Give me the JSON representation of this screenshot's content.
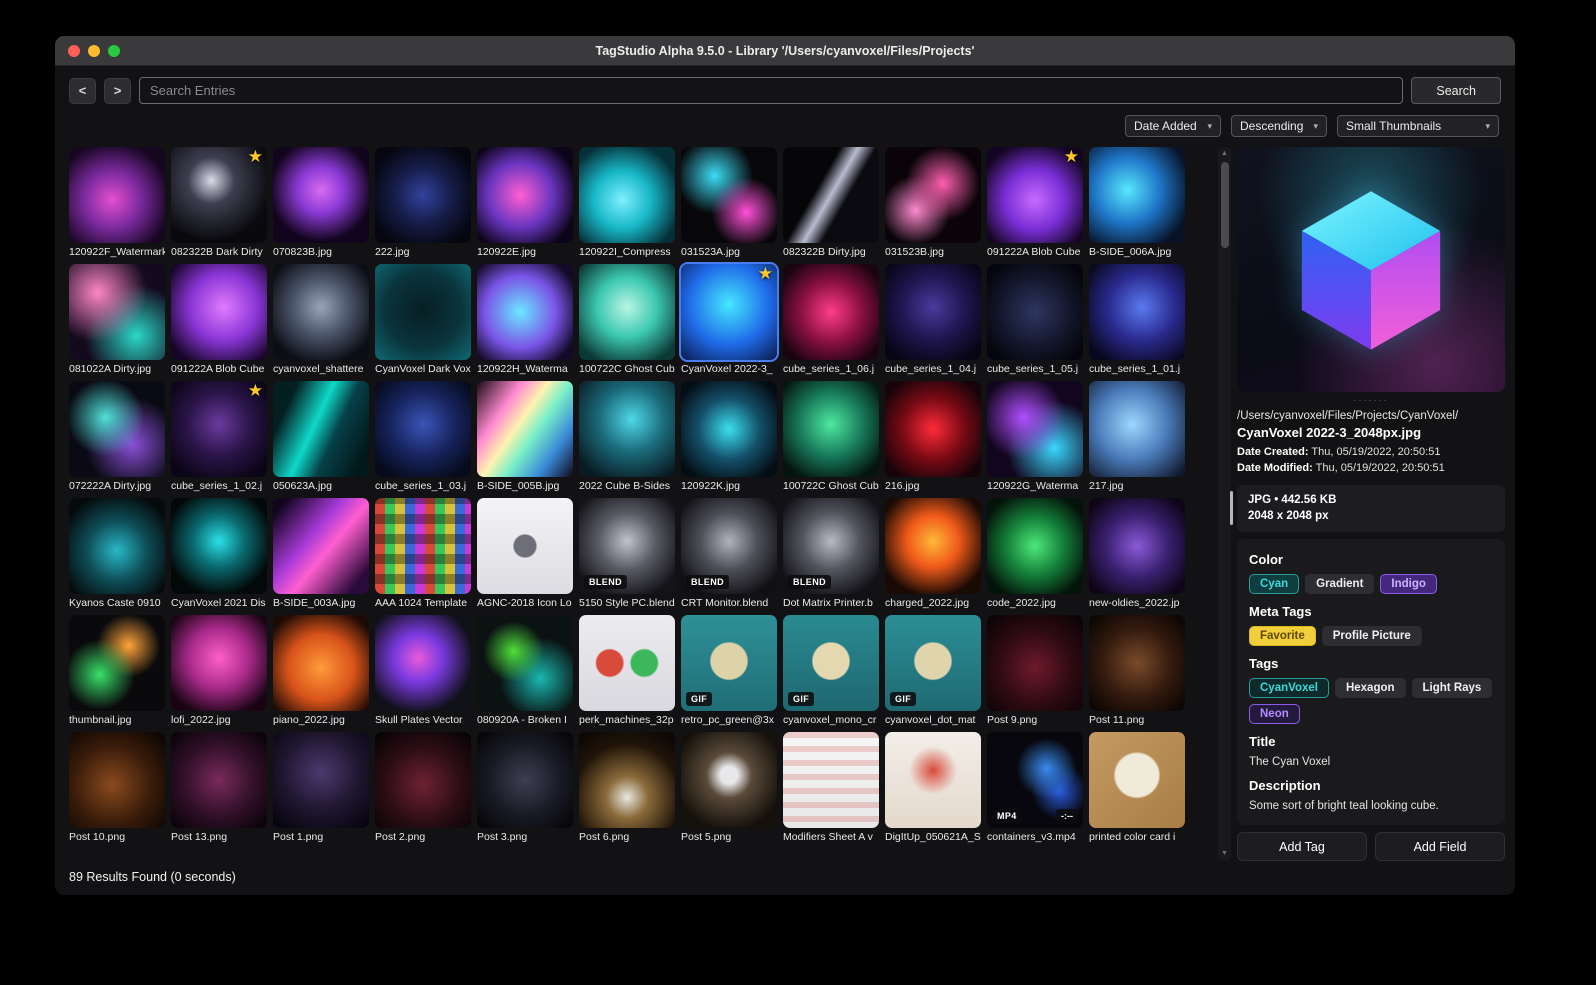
{
  "icons": {
    "caret_down": "▾",
    "scroll_up": "▲",
    "scroll_down": "▼",
    "star": "★"
  },
  "colors": {
    "selection": "#4a7df0",
    "favorite_star": "#ffc82a",
    "accent_cyan": "#3ad9d9",
    "accent_purple": "#8a5ce8"
  },
  "window": {
    "title": "TagStudio Alpha 9.5.0 - Library '/Users/cyanvoxel/Files/Projects'"
  },
  "toolbar": {
    "back": "<",
    "forward": ">",
    "search_placeholder": "Search Entries",
    "search_button": "Search"
  },
  "sort_bar": {
    "sort_field": "Date Added",
    "direction": "Descending",
    "thumb_size": "Small Thumbnails"
  },
  "status_bar": {
    "results": "89 Results Found (0 seconds)"
  },
  "grid": {
    "items": [
      {
        "name": "120922F_Watermark",
        "bg": "radial-gradient(circle at 45% 55%, #e44fd0 0%, #7b2a9e 38%, #16061f 78%)"
      },
      {
        "name": "082322B Dark Dirty",
        "favorite": true,
        "bg": "radial-gradient(circle at 42% 35%, #d8dbe8 0%, #3e3e50 28%, #0a0a0e 72%)"
      },
      {
        "name": "070823B.jpg",
        "bg": "radial-gradient(circle at 50% 45%, #d86bf0 0%, #8b3ad6 32%, #12041c 72%)"
      },
      {
        "name": "222.jpg",
        "bg": "radial-gradient(circle at 50% 50%, #32429e 0%, #161d48 42%, #05060f 82%)"
      },
      {
        "name": "120922E.jpg",
        "bg": "radial-gradient(circle at 45% 50%, #ff5fd0 0%, #6a35c0 45%, #0c0418 82%)"
      },
      {
        "name": "120922I_Compress",
        "bg": "radial-gradient(circle at 45% 55%, #7ff0ff 0%, #18b8c8 38%, #063038 78%)"
      },
      {
        "name": "031523A.jpg",
        "bg": "radial-gradient(circle at 68% 68%, #ff4fd8 0%, rgba(0,0,0,0) 38%), radial-gradient(circle at 35% 30%, #3ddcf5 0%, rgba(0,0,0,0) 42%), #070709"
      },
      {
        "name": "082322B Dirty.jpg",
        "bg": "linear-gradient(120deg, #060609 38%, #b9bcd0 50%, #0a0a10 62%)"
      },
      {
        "name": "031523B.jpg",
        "bg": "radial-gradient(circle at 60% 38%, #ff5fb0 0%, rgba(0,0,0,0) 45%), radial-gradient(circle at 32% 66%, #ff8ad0 0%, rgba(0,0,0,0) 38%), #0a0409"
      },
      {
        "name": "091222A Blob Cube",
        "favorite": true,
        "bg": "radial-gradient(circle at 50% 55%, #c86bff 0%, #7a2ed6 42%, #140522 82%)"
      },
      {
        "name": "B-SIDE_006A.jpg",
        "bg": "radial-gradient(circle at 40% 45%, #58e8ff 0%, #1f76c8 42%, #071226 82%)"
      },
      {
        "name": "081022A Dirty.jpg",
        "bg": "radial-gradient(circle at 30% 30%, #ff87c6 0%, rgba(0,0,0,0) 52%), radial-gradient(circle at 70% 75%, #2ad8c8 0%, rgba(0,0,0,0) 52%), #140a1e"
      },
      {
        "name": "091222A Blob Cube",
        "bg": "radial-gradient(circle at 55% 45%, #e07bff 0%, #8a35d6 45%, #17062a 85%)"
      },
      {
        "name": "cyanvoxel_shattere",
        "bg": "radial-gradient(circle at 50% 45%, #9aa4b8 0%, #4a5468 40%, #0c0e16 80%)"
      },
      {
        "name": "CyanVoxel Dark Vox",
        "bg": "radial-gradient(circle at 50% 48%, #071e24 0%, #0a343c 55%, #0f6a74 100%)"
      },
      {
        "name": "120922H_Waterma",
        "bg": "radial-gradient(circle at 45% 50%, #6be8ff 0%, #7a55e8 50%, #130a28 85%)"
      },
      {
        "name": "100722C Ghost Cub",
        "bg": "radial-gradient(circle at 50% 45%, #baf5e6 0%, #3cc8b0 42%, #0b3a36 85%)"
      },
      {
        "name": "CyanVoxel 2022-3_",
        "selected": true,
        "favorite": true,
        "bg": "radial-gradient(circle at 50% 42%, #45e8ff 0%, #1f6ae8 55%, #0a1a4a 100%)"
      },
      {
        "name": "cube_series_1_06.j",
        "bg": "radial-gradient(circle at 50% 50%, #ff3d8a 0%, #8a1040 45%, #1a0410 85%)"
      },
      {
        "name": "cube_series_1_04.j",
        "bg": "radial-gradient(circle at 50% 45%, #4a3a9e 0%, #1f1650 45%, #070514 85%)"
      },
      {
        "name": "cube_series_1_05.j",
        "bg": "radial-gradient(circle at 50% 50%, #2e3560 0%, #14182e 50%, #05060d 85%)"
      },
      {
        "name": "cube_series_1_01.j",
        "bg": "radial-gradient(circle at 55% 45%, #5a7af0 0%, #2a2a8e 45%, #090820 85%)"
      },
      {
        "name": "072222A Dirty.jpg",
        "bg": "radial-gradient(circle at 38% 38%, #4fe0d8 0%, rgba(0,0,0,0) 46%), radial-gradient(circle at 66% 66%, #8a4fd8 0%, rgba(0,0,0,0) 52%), #0a0a14"
      },
      {
        "name": "cube_series_1_02.j",
        "favorite": true,
        "bg": "radial-gradient(circle at 50% 45%, #6a3a9e 0%, #2a1448 45%, #0a0516 85%)"
      },
      {
        "name": "050623A.jpg",
        "bg": "linear-gradient(115deg, #041f22 18%, #0fd8c8 44%, #064048 62%, #02171a 90%)"
      },
      {
        "name": "cube_series_1_03.j",
        "bg": "radial-gradient(circle at 50% 45%, #3a55b8 0%, #17245e 45%, #060a1a 85%)"
      },
      {
        "name": "B-SIDE_005B.jpg",
        "bg": "linear-gradient(125deg, #1a0a14 0%, #ff8ad0 28%, #fff2b0 44%, #7af0c8 58%, #3a8ad8 78%, #10081a 100%)"
      },
      {
        "name": "2022 Cube B-Sides",
        "bg": "radial-gradient(circle at 55% 40%, #4fd8e8 0%, #1a6a7a 42%, #0a1a22 85%)"
      },
      {
        "name": "120922K.jpg",
        "bg": "radial-gradient(circle at 50% 50%, #3ae0f0 0%, #14506a 45%, #040d14 85%)"
      },
      {
        "name": "100722C Ghost Cub",
        "bg": "radial-gradient(circle at 50% 45%, #4fe8a0 0%, #17795a 45%, #04140e 85%)"
      },
      {
        "name": "216.jpg",
        "bg": "radial-gradient(circle at 50% 50%, #ff2a3a 0%, #7a0a14 45%, #16040a 85%)"
      },
      {
        "name": "120922G_Waterma",
        "bg": "radial-gradient(circle at 38% 38%, #b04fff 0%, rgba(0,0,0,0) 50%), radial-gradient(circle at 70% 70%, #3ad8ff 0%, rgba(0,0,0,0) 50%), #12051e"
      },
      {
        "name": "217.jpg",
        "bg": "radial-gradient(circle at 45% 45%, #9ad8ff 0%, #4a7ab8 48%, #101a2e 92%)"
      },
      {
        "name": "Kyanos Caste 0910",
        "bg": "radial-gradient(circle at 50% 55%, #2ab8c8 0%, #0e4e58 42%, #050b0d 82%)"
      },
      {
        "name": "CyanVoxel 2021 Dis",
        "bg": "radial-gradient(circle at 50% 45%, #2ae0e8 0%, #0a6a70 36%, #030808 76%)"
      },
      {
        "name": "B-SIDE_003A.jpg",
        "bg": "linear-gradient(130deg, #12051e 8%, #a83ad8 40%, #ff5fd0 56%, #2a0a3a 88%)"
      },
      {
        "name": "AAA 1024 Template",
        "bg": "repeating-linear-gradient(0deg, rgba(0,0,0,0) 0 10px, rgba(0,0,0,0.35) 10px 20px), repeating-linear-gradient(90deg, #d8493a 0 10px, #3ac85a 10px 20px, #d8c23a 20px 30px, #3a6ad8 30px 40px, #c83ad8 40px 50px)"
      },
      {
        "name": "AGNC-2018 Icon Lo",
        "bg": "radial-gradient(circle at 50% 50%, #6e6e78 0%, #6e6e78 16%, rgba(0,0,0,0) 18%), linear-gradient(180deg, #f4f4f6 0%, #dcdce2 100%)"
      },
      {
        "name": "5150 Style PC.blend",
        "badge": "BLEND",
        "bg": "radial-gradient(circle at 50% 45%, #c2c2cc 0%, #5a5a64 40%, #131318 82%)"
      },
      {
        "name": "CRT Monitor.blend",
        "badge": "BLEND",
        "bg": "radial-gradient(circle at 50% 45%, #b2b2bc 0%, #4e4e58 40%, #101014 82%)"
      },
      {
        "name": "Dot Matrix Printer.b",
        "badge": "BLEND",
        "bg": "radial-gradient(circle at 50% 45%, #babac4 0%, #54545e 40%, #111116 82%)"
      },
      {
        "name": "charged_2022.jpg",
        "bg": "radial-gradient(circle at 50% 45%, #ffb83a 0%, #f05a1a 36%, #1a0a04 78%)"
      },
      {
        "name": "code_2022.jpg",
        "bg": "radial-gradient(circle at 50% 50%, #4fe87a 0%, #14803a 42%, #04140a 82%)"
      },
      {
        "name": "new-oldies_2022.jp",
        "bg": "radial-gradient(circle at 50% 50%, #8a5ad8 0%, #3a2070 46%, #0e0618 86%)"
      },
      {
        "name": "thumbnail.jpg",
        "bg": "radial-gradient(circle at 32% 62%, #3ae06a 0%, rgba(0,0,0,0) 40%), radial-gradient(circle at 62% 32%, #ffa53a 0%, rgba(0,0,0,0) 36%), #0a0a0c"
      },
      {
        "name": "lofi_2022.jpg",
        "bg": "radial-gradient(circle at 50% 45%, #ff5fc8 0%, #a82a8a 42%, #1a0414 82%)"
      },
      {
        "name": "piano_2022.jpg",
        "bg": "radial-gradient(circle at 50% 55%, #ff9a3a 0%, #d8531a 46%, #1c0a04 86%)"
      },
      {
        "name": "Skull Plates Vector",
        "bg": "radial-gradient(circle at 45% 45%, #e85ad8 0%, #7a3ae0 32%, #101018 74%)"
      },
      {
        "name": "080920A - Broken I",
        "bg": "radial-gradient(circle at 38% 38%, #4fe03a 0%, rgba(0,0,0,0) 36%), radial-gradient(circle at 66% 66%, #1ab8b0 0%, rgba(0,0,0,0) 46%), #0a1212"
      },
      {
        "name": "perk_machines_32p",
        "bg": "radial-gradient(circle at 32% 50%, #d84a3a 0%, #d84a3a 16%, rgba(0,0,0,0) 18%), radial-gradient(circle at 68% 50%, #3ab85a 0%, #3ab85a 16%, rgba(0,0,0,0) 18%), linear-gradient(180deg, #ececf0, #d8d8de)"
      },
      {
        "name": "retro_pc_green@3x",
        "badge": "GIF",
        "bg": "radial-gradient(circle at 50% 48%, #ded2a8 0%, #ded2a8 26%, rgba(0,0,0,0) 28%), linear-gradient(180deg, #2e9098 0%, #206e76 100%)"
      },
      {
        "name": "cyanvoxel_mono_cr",
        "badge": "GIF",
        "bg": "radial-gradient(circle at 50% 48%, #e4d8b0 0%, #e4d8b0 26%, rgba(0,0,0,0) 28%), linear-gradient(180deg, #2a8a92 0%, #1e6870 100%)"
      },
      {
        "name": "cyanvoxel_dot_mat",
        "badge": "GIF",
        "bg": "radial-gradient(circle at 50% 48%, #e0d4ac 0%, #e0d4ac 26%, rgba(0,0,0,0) 28%), linear-gradient(180deg, #2c8e96 0%, #1f6a72 100%)"
      },
      {
        "name": "Post 9.png",
        "bg": "radial-gradient(circle at 50% 55%, #6e1a2a 0%, #2e0a12 52%, #0c0406 92%)"
      },
      {
        "name": "Post 11.png",
        "bg": "radial-gradient(circle at 50% 50%, #7a4a2a 0%, #331a0e 52%, #0c0604 92%)"
      },
      {
        "name": "Post 10.png",
        "bg": "radial-gradient(circle at 45% 55%, #8a4a1e 0%, #3a1c0a 52%, #0e0603 92%)"
      },
      {
        "name": "Post 13.png",
        "bg": "radial-gradient(circle at 50% 50%, #7a2a5a 0%, #32102a 52%, #0c040a 92%)"
      },
      {
        "name": "Post 1.png",
        "bg": "radial-gradient(circle at 50% 42%, #4a3a6e 0%, #1f1630 52%, #080510 92%)"
      },
      {
        "name": "Post 2.png",
        "bg": "radial-gradient(circle at 50% 55%, #6e2230 0%, #2a0c14 55%, #0a0406 92%)"
      },
      {
        "name": "Post 3.png",
        "bg": "radial-gradient(circle at 50% 50%, #3e3e52 0%, #1a1a26 52%, #070709 92%)"
      },
      {
        "name": "Post 6.png",
        "bg": "radial-gradient(circle at 50% 68%, #e8e8e0 0%, #8a6a3a 26%, #201408 66%, #0a0604 96%)"
      },
      {
        "name": "Post 5.png",
        "bg": "radial-gradient(circle at 50% 45%, #e8e8ea 0%, #e8e8ea 12%, #5a4a3a 32%, #14100a 78%)"
      },
      {
        "name": "Modifiers Sheet A v",
        "bg": "repeating-linear-gradient(180deg, rgba(200,60,50,0.22) 0 6px, rgba(0,0,0,0) 6px 14px), linear-gradient(180deg, #f6f6f6, #e8e8e8)"
      },
      {
        "name": "DigItUp_050621A_S",
        "bg": "radial-gradient(circle at 50% 40%, #d84a3a 0%, rgba(0,0,0,0) 32%), linear-gradient(180deg, #f2eee8, #e4d8cc)"
      },
      {
        "name": "containers_v3.mp4",
        "badge": "MP4",
        "badge_right": "-:--",
        "bg": "radial-gradient(circle at 62% 38%, #3a8af0 0%, rgba(0,0,0,0) 36%), radial-gradient(circle at 76% 62%, #2a5ad8 0%, rgba(0,0,0,0) 30%), #07070d"
      },
      {
        "name": "printed color card i",
        "bg": "radial-gradient(circle at 50% 45%, #f0ead8 0%, #f0ead8 30%, rgba(0,0,0,0) 33%), linear-gradient(135deg, #c49a62, #a87e46)"
      }
    ]
  },
  "preview": {
    "resize_handle": "·······",
    "path": "/Users/cyanvoxel/Files/Projects/CyanVoxel/",
    "filename": "CyanVoxel 2022-3_2048px.jpg",
    "date_created_label": "Date Created:",
    "date_created_value": "Thu, 05/19/2022, 20:50:51",
    "date_modified_label": "Date Modified:",
    "date_modified_value": "Thu, 05/19/2022, 20:50:51",
    "file_info_line1": "JPG  •  442.56 KB",
    "file_info_line2": "2048 x 2048 px",
    "fields": [
      {
        "label": "Color",
        "pills": [
          {
            "text": "Cyan",
            "bg": "#103d3f",
            "fg": "#3ad9d9",
            "border": "#2a9a9c"
          },
          {
            "text": "Gradient",
            "bg": "#2e2e32",
            "fg": "#f0f0f0"
          },
          {
            "text": "Indigo",
            "bg": "#44287e",
            "fg": "#cdb3ff",
            "border": "#8a5ce8"
          }
        ]
      },
      {
        "label": "Meta Tags",
        "pills": [
          {
            "text": "Favorite",
            "bg": "#f0cf3a",
            "fg": "#5e4a00",
            "border": "#d8b820"
          },
          {
            "text": "Profile Picture",
            "bg": "#2e2e32",
            "fg": "#f0f0f0"
          }
        ]
      },
      {
        "label": "Tags",
        "pills": [
          {
            "text": "CyanVoxel",
            "bg": "#0e2a2b",
            "fg": "#3ad9d9",
            "border": "#2a9a9c"
          },
          {
            "text": "Hexagon",
            "bg": "#2e2e32",
            "fg": "#f0f0f0"
          },
          {
            "text": "Light Rays",
            "bg": "#2e2e32",
            "fg": "#f0f0f0"
          },
          {
            "text": "Neon",
            "bg": "#241a3e",
            "fg": "#b48aff",
            "border": "#8a5ce8"
          }
        ]
      },
      {
        "label": "Title",
        "text": "The Cyan Voxel"
      },
      {
        "label": "Description",
        "text": "Some sort of bright teal looking cube."
      }
    ],
    "add_tag_button": "Add Tag",
    "add_field_button": "Add Field"
  }
}
